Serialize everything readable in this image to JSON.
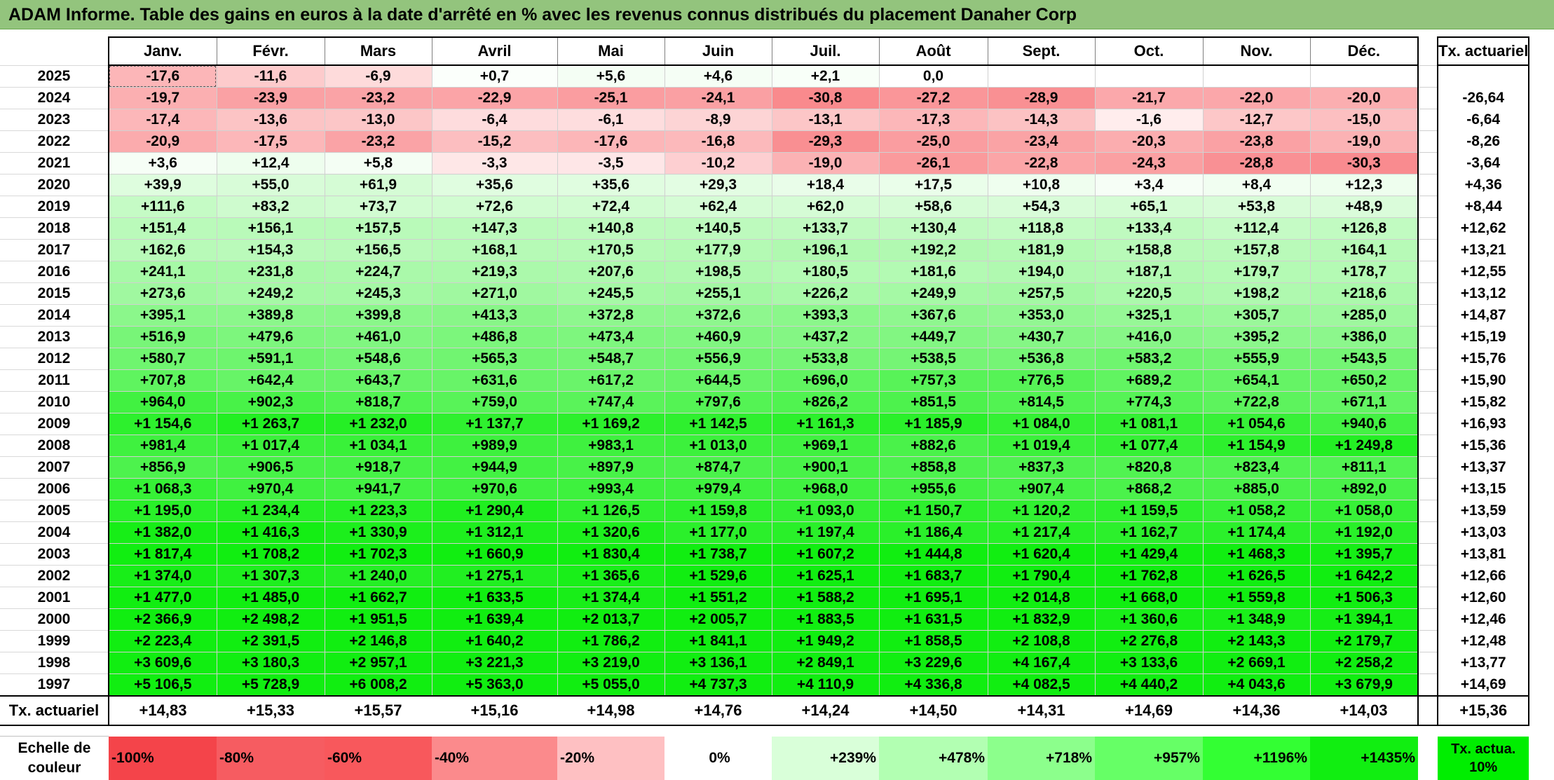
{
  "title": "ADAM Informe. Table des gains en euros à la date d'arrêté en % avec les revenus connus distribués du placement Danaher Corp",
  "months": [
    "Janv.",
    "Févr.",
    "Mars",
    "Avril",
    "Mai",
    "Juin",
    "Juil.",
    "Août",
    "Sept.",
    "Oct.",
    "Nov.",
    "Déc."
  ],
  "tx_header": "Tx. actuariel",
  "rows": [
    {
      "year": "2025",
      "values": [
        "-17,6",
        "-11,6",
        "-6,9",
        "+0,7",
        "+5,6",
        "+4,6",
        "+2,1",
        "0,0",
        "",
        "",
        "",
        ""
      ],
      "tx": ""
    },
    {
      "year": "2024",
      "values": [
        "-19,7",
        "-23,9",
        "-23,2",
        "-22,9",
        "-25,1",
        "-24,1",
        "-30,8",
        "-27,2",
        "-28,9",
        "-21,7",
        "-22,0",
        "-20,0"
      ],
      "tx": "-26,64"
    },
    {
      "year": "2023",
      "values": [
        "-17,4",
        "-13,6",
        "-13,0",
        "-6,4",
        "-6,1",
        "-8,9",
        "-13,1",
        "-17,3",
        "-14,3",
        "-1,6",
        "-12,7",
        "-15,0"
      ],
      "tx": "-6,64"
    },
    {
      "year": "2022",
      "values": [
        "-20,9",
        "-17,5",
        "-23,2",
        "-15,2",
        "-17,6",
        "-16,8",
        "-29,3",
        "-25,0",
        "-23,4",
        "-20,3",
        "-23,8",
        "-19,0"
      ],
      "tx": "-8,26"
    },
    {
      "year": "2021",
      "values": [
        "+3,6",
        "+12,4",
        "+5,8",
        "-3,3",
        "-3,5",
        "-10,2",
        "-19,0",
        "-26,1",
        "-22,8",
        "-24,3",
        "-28,8",
        "-30,3"
      ],
      "tx": "-3,64"
    },
    {
      "year": "2020",
      "values": [
        "+39,9",
        "+55,0",
        "+61,9",
        "+35,6",
        "+35,6",
        "+29,3",
        "+18,4",
        "+17,5",
        "+10,8",
        "+3,4",
        "+8,4",
        "+12,3"
      ],
      "tx": "+4,36"
    },
    {
      "year": "2019",
      "values": [
        "+111,6",
        "+83,2",
        "+73,7",
        "+72,6",
        "+72,4",
        "+62,4",
        "+62,0",
        "+58,6",
        "+54,3",
        "+65,1",
        "+53,8",
        "+48,9"
      ],
      "tx": "+8,44"
    },
    {
      "year": "2018",
      "values": [
        "+151,4",
        "+156,1",
        "+157,5",
        "+147,3",
        "+140,8",
        "+140,5",
        "+133,7",
        "+130,4",
        "+118,8",
        "+133,4",
        "+112,4",
        "+126,8"
      ],
      "tx": "+12,62"
    },
    {
      "year": "2017",
      "values": [
        "+162,6",
        "+154,3",
        "+156,5",
        "+168,1",
        "+170,5",
        "+177,9",
        "+196,1",
        "+192,2",
        "+181,9",
        "+158,8",
        "+157,8",
        "+164,1"
      ],
      "tx": "+13,21"
    },
    {
      "year": "2016",
      "values": [
        "+241,1",
        "+231,8",
        "+224,7",
        "+219,3",
        "+207,6",
        "+198,5",
        "+180,5",
        "+181,6",
        "+194,0",
        "+187,1",
        "+179,7",
        "+178,7"
      ],
      "tx": "+12,55"
    },
    {
      "year": "2015",
      "values": [
        "+273,6",
        "+249,2",
        "+245,3",
        "+271,0",
        "+245,5",
        "+255,1",
        "+226,2",
        "+249,9",
        "+257,5",
        "+220,5",
        "+198,2",
        "+218,6"
      ],
      "tx": "+13,12"
    },
    {
      "year": "2014",
      "values": [
        "+395,1",
        "+389,8",
        "+399,8",
        "+413,3",
        "+372,8",
        "+372,6",
        "+393,3",
        "+367,6",
        "+353,0",
        "+325,1",
        "+305,7",
        "+285,0"
      ],
      "tx": "+14,87"
    },
    {
      "year": "2013",
      "values": [
        "+516,9",
        "+479,6",
        "+461,0",
        "+486,8",
        "+473,4",
        "+460,9",
        "+437,2",
        "+449,7",
        "+430,7",
        "+416,0",
        "+395,2",
        "+386,0"
      ],
      "tx": "+15,19"
    },
    {
      "year": "2012",
      "values": [
        "+580,7",
        "+591,1",
        "+548,6",
        "+565,3",
        "+548,7",
        "+556,9",
        "+533,8",
        "+538,5",
        "+536,8",
        "+583,2",
        "+555,9",
        "+543,5"
      ],
      "tx": "+15,76"
    },
    {
      "year": "2011",
      "values": [
        "+707,8",
        "+642,4",
        "+643,7",
        "+631,6",
        "+617,2",
        "+644,5",
        "+696,0",
        "+757,3",
        "+776,5",
        "+689,2",
        "+654,1",
        "+650,2"
      ],
      "tx": "+15,90"
    },
    {
      "year": "2010",
      "values": [
        "+964,0",
        "+902,3",
        "+818,7",
        "+759,0",
        "+747,4",
        "+797,6",
        "+826,2",
        "+851,5",
        "+814,5",
        "+774,3",
        "+722,8",
        "+671,1"
      ],
      "tx": "+15,82"
    },
    {
      "year": "2009",
      "values": [
        "+1 154,6",
        "+1 263,7",
        "+1 232,0",
        "+1 137,7",
        "+1 169,2",
        "+1 142,5",
        "+1 161,3",
        "+1 185,9",
        "+1 084,0",
        "+1 081,1",
        "+1 054,6",
        "+940,6"
      ],
      "tx": "+16,93"
    },
    {
      "year": "2008",
      "values": [
        "+981,4",
        "+1 017,4",
        "+1 034,1",
        "+989,9",
        "+983,1",
        "+1 013,0",
        "+969,1",
        "+882,6",
        "+1 019,4",
        "+1 077,4",
        "+1 154,9",
        "+1 249,8"
      ],
      "tx": "+15,36"
    },
    {
      "year": "2007",
      "values": [
        "+856,9",
        "+906,5",
        "+918,7",
        "+944,9",
        "+897,9",
        "+874,7",
        "+900,1",
        "+858,8",
        "+837,3",
        "+820,8",
        "+823,4",
        "+811,1"
      ],
      "tx": "+13,37"
    },
    {
      "year": "2006",
      "values": [
        "+1 068,3",
        "+970,4",
        "+941,7",
        "+970,6",
        "+993,4",
        "+979,4",
        "+968,0",
        "+955,6",
        "+907,4",
        "+868,2",
        "+885,0",
        "+892,0"
      ],
      "tx": "+13,15"
    },
    {
      "year": "2005",
      "values": [
        "+1 195,0",
        "+1 234,4",
        "+1 223,3",
        "+1 290,4",
        "+1 126,5",
        "+1 159,8",
        "+1 093,0",
        "+1 150,7",
        "+1 120,2",
        "+1 159,5",
        "+1 058,2",
        "+1 058,0"
      ],
      "tx": "+13,59"
    },
    {
      "year": "2004",
      "values": [
        "+1 382,0",
        "+1 416,3",
        "+1 330,9",
        "+1 312,1",
        "+1 320,6",
        "+1 177,0",
        "+1 197,4",
        "+1 186,4",
        "+1 217,4",
        "+1 162,7",
        "+1 174,4",
        "+1 192,0"
      ],
      "tx": "+13,03"
    },
    {
      "year": "2003",
      "values": [
        "+1 817,4",
        "+1 708,2",
        "+1 702,3",
        "+1 660,9",
        "+1 830,4",
        "+1 738,7",
        "+1 607,2",
        "+1 444,8",
        "+1 620,4",
        "+1 429,4",
        "+1 468,3",
        "+1 395,7"
      ],
      "tx": "+13,81"
    },
    {
      "year": "2002",
      "values": [
        "+1 374,0",
        "+1 307,3",
        "+1 240,0",
        "+1 275,1",
        "+1 365,6",
        "+1 529,6",
        "+1 625,1",
        "+1 683,7",
        "+1 790,4",
        "+1 762,8",
        "+1 626,5",
        "+1 642,2"
      ],
      "tx": "+12,66"
    },
    {
      "year": "2001",
      "values": [
        "+1 477,0",
        "+1 485,0",
        "+1 662,7",
        "+1 633,5",
        "+1 374,4",
        "+1 551,2",
        "+1 588,2",
        "+1 695,1",
        "+2 014,8",
        "+1 668,0",
        "+1 559,8",
        "+1 506,3"
      ],
      "tx": "+12,60"
    },
    {
      "year": "2000",
      "values": [
        "+2 366,9",
        "+2 498,2",
        "+1 951,5",
        "+1 639,4",
        "+2 013,7",
        "+2 005,7",
        "+1 883,5",
        "+1 631,5",
        "+1 832,9",
        "+1 360,6",
        "+1 348,9",
        "+1 394,1"
      ],
      "tx": "+12,46"
    },
    {
      "year": "1999",
      "values": [
        "+2 223,4",
        "+2 391,5",
        "+2 146,8",
        "+1 640,2",
        "+1 786,2",
        "+1 841,1",
        "+1 949,2",
        "+1 858,5",
        "+2 108,8",
        "+2 276,8",
        "+2 143,3",
        "+2 179,7"
      ],
      "tx": "+12,48"
    },
    {
      "year": "1998",
      "values": [
        "+3 609,6",
        "+3 180,3",
        "+2 957,1",
        "+3 221,3",
        "+3 219,0",
        "+3 136,1",
        "+2 849,1",
        "+3 229,6",
        "+4 167,4",
        "+3 133,6",
        "+2 669,1",
        "+2 258,2"
      ],
      "tx": "+13,77"
    },
    {
      "year": "1997",
      "values": [
        "+5 106,5",
        "+5 728,9",
        "+6 008,2",
        "+5 363,0",
        "+5 055,0",
        "+4 737,3",
        "+4 110,9",
        "+4 336,8",
        "+4 082,5",
        "+4 440,2",
        "+4 043,6",
        "+3 679,9"
      ],
      "tx": "+14,69"
    }
  ],
  "averages": {
    "label": "Tx. actuariel",
    "values": [
      "+14,83",
      "+15,33",
      "+15,57",
      "+15,16",
      "+14,98",
      "+14,76",
      "+14,24",
      "+14,50",
      "+14,31",
      "+14,69",
      "+14,36",
      "+14,03"
    ],
    "tx": "+15,36"
  },
  "scale": {
    "label": "Echelle de couleur",
    "items": [
      "-100%",
      "-80%",
      "-60%",
      "-40%",
      "-20%",
      "0%",
      "+239%",
      "+478%",
      "+718%",
      "+957%",
      "+1196%",
      "+1435%"
    ],
    "colors": [
      "#f4444a",
      "#f65c61",
      "#f8585c",
      "#fb8a8c",
      "#fec0c2",
      "#ffffff",
      "#d9ffd9",
      "#b2ffb2",
      "#8cff8c",
      "#66ff66",
      "#33ff33",
      "#11ee11"
    ],
    "tx_label": "Tx. actua. 10%"
  }
}
